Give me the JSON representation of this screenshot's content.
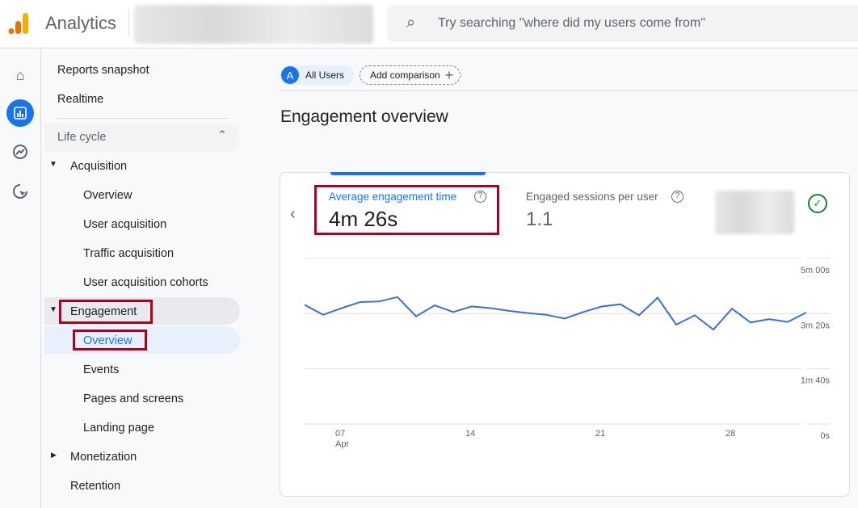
{
  "header": {
    "app_name": "Analytics",
    "search_placeholder": "Try searching \"where did my users come from\""
  },
  "rail": {
    "items": [
      "home-icon",
      "reports-icon",
      "explore-icon",
      "advertising-icon"
    ],
    "active": "reports-icon"
  },
  "nav": {
    "top": [
      "Reports snapshot",
      "Realtime"
    ],
    "section": "Life cycle",
    "acquisition": {
      "label": "Acquisition",
      "items": [
        "Overview",
        "User acquisition",
        "Traffic acquisition",
        "User acquisition cohorts"
      ]
    },
    "engagement": {
      "label": "Engagement",
      "items": [
        "Overview",
        "Events",
        "Pages and screens",
        "Landing page"
      ]
    },
    "monetization": "Monetization",
    "retention": "Retention"
  },
  "comparison": {
    "segment_letter": "A",
    "segment": "All Users",
    "add": "Add comparison"
  },
  "page_title": "Engagement overview",
  "card": {
    "metric1": {
      "label": "Average engagement time",
      "value": "4m 26s"
    },
    "metric2": {
      "label": "Engaged sessions per user",
      "value": "1.1"
    }
  },
  "colors": {
    "accent": "#1a73e8",
    "line": "#3b6fd0",
    "highlight": "#b00020"
  },
  "chart_data": {
    "type": "line",
    "y_unit": "seconds",
    "ylim": [
      0,
      300
    ],
    "y_ticks": [
      {
        "v": 300,
        "label": "5m 00s"
      },
      {
        "v": 200,
        "label": "3m 20s"
      },
      {
        "v": 100,
        "label": "1m 40s"
      },
      {
        "v": 0,
        "label": "0s"
      }
    ],
    "x_ticks": [
      {
        "day": 7,
        "label": "07",
        "sub": "Apr"
      },
      {
        "day": 14,
        "label": "14"
      },
      {
        "day": 21,
        "label": "21"
      },
      {
        "day": 28,
        "label": "28"
      }
    ],
    "x_start_day": 5,
    "values": [
      216,
      198,
      210,
      221,
      222,
      230,
      195,
      215,
      203,
      213,
      210,
      205,
      201,
      198,
      191,
      203,
      213,
      217,
      197,
      229,
      180,
      197,
      171,
      209,
      184,
      190,
      185,
      202
    ],
    "grid": true
  }
}
